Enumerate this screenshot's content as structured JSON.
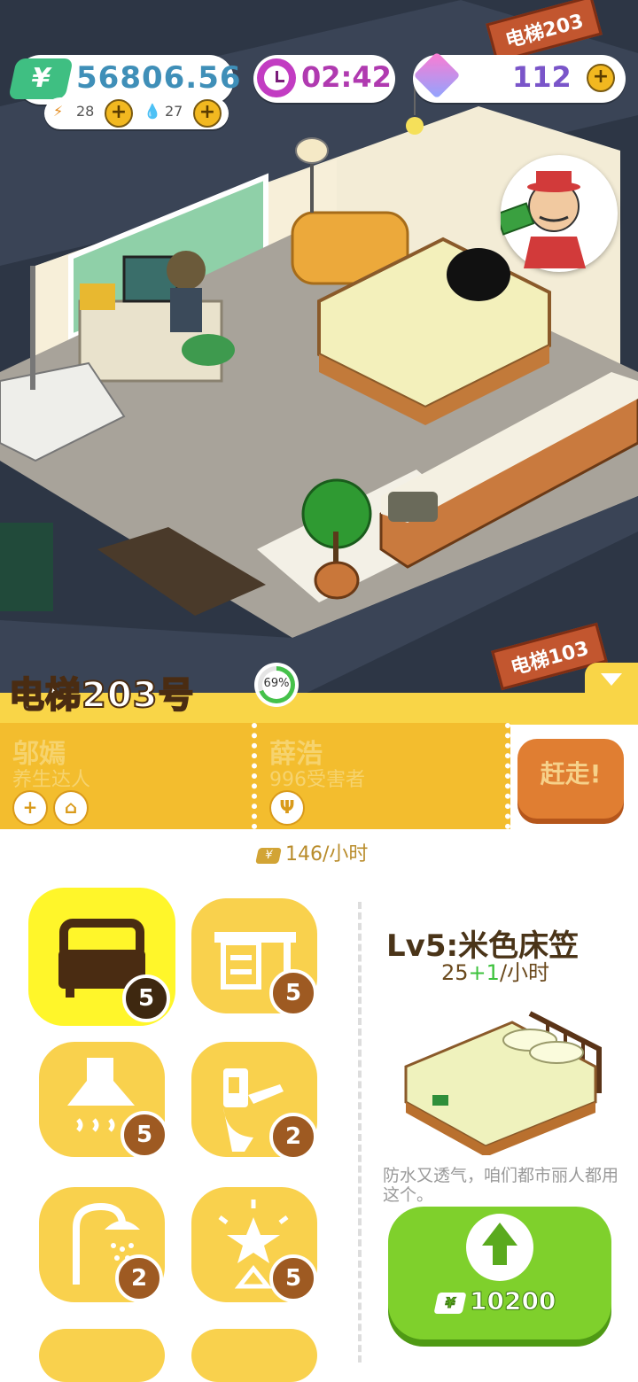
{
  "hud": {
    "money": "56806.56",
    "energy": "28",
    "water": "27",
    "timer": "02:42",
    "gems": "112"
  },
  "room": {
    "sign_current": "电梯203",
    "sign_below": "电梯103",
    "title": "电梯203号",
    "progress_label": "69%",
    "progress": 0.69
  },
  "tenants": [
    {
      "name": "邬嫣",
      "title": "养生达人"
    },
    {
      "name": "薛浩",
      "title": "996受害者"
    }
  ],
  "evict_label": "赶走!",
  "income": "146/小时",
  "furniture": [
    {
      "icon": "bed-icon",
      "count": "5",
      "selected": true
    },
    {
      "icon": "desk-icon",
      "count": "5"
    },
    {
      "icon": "range-hood-icon",
      "count": "5"
    },
    {
      "icon": "toilet-icon",
      "count": "2"
    },
    {
      "icon": "shower-icon",
      "count": "2"
    },
    {
      "icon": "star-lamp-icon",
      "count": "5"
    }
  ],
  "detail": {
    "title": "Lv5:米色床笠",
    "rate_base": "25",
    "rate_bonus": "+1",
    "rate_unit": "/小时",
    "description": "防水又透气，咱们都市丽人都用这个。",
    "upgrade_cost": "10200"
  },
  "colors": {
    "panel_yellow": "#f9d547",
    "selected_tile": "#fff62a",
    "upgrade_green": "#7fd02c",
    "evict_orange": "#e07e32"
  }
}
